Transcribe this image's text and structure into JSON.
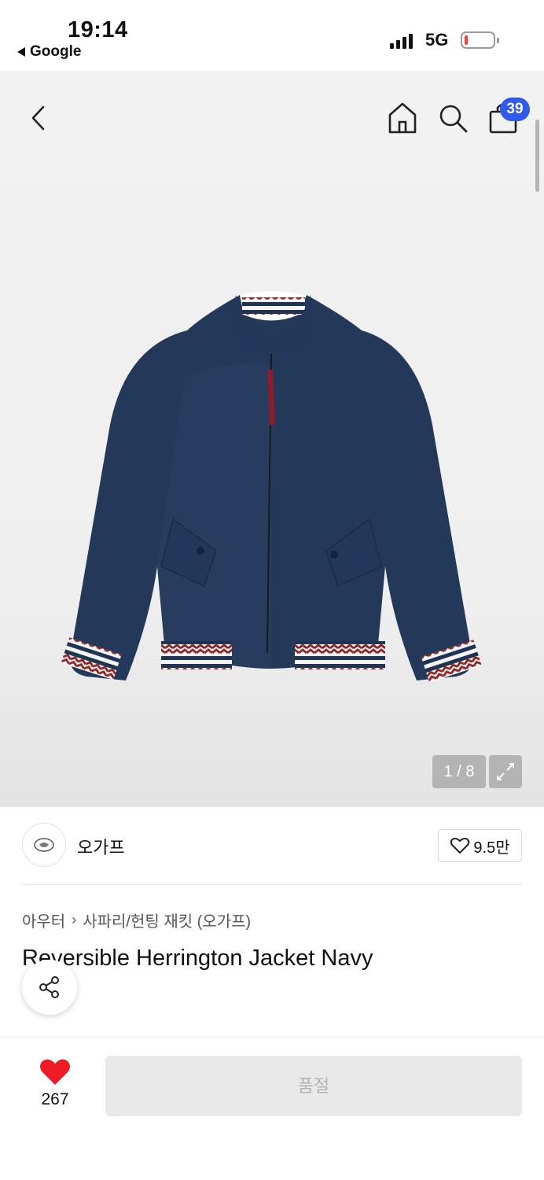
{
  "status_bar": {
    "time": "19:14",
    "back_app": "Google",
    "network": "5G",
    "battery_level": 0.12
  },
  "header": {
    "back_icon": "chevron-left-icon",
    "home_icon": "home-icon",
    "search_icon": "search-icon",
    "bag_icon": "shopping-bag-icon",
    "bag_badge": "39",
    "badge_color": "#2f5bea"
  },
  "gallery": {
    "counter": "1 / 8",
    "expand_icon": "expand-icon"
  },
  "brand": {
    "name": "오가프",
    "likes": "9.5만",
    "heart_icon": "heart-outline-icon"
  },
  "breadcrumb": {
    "category": "아우터",
    "subcategory": "사파리/헌팅 재킷 (오가프)"
  },
  "product": {
    "title": "Reversible Herrington Jacket Navy"
  },
  "bottom_bar": {
    "wish_count": "267",
    "wish_color": "#ee1c25",
    "cta_label": "품절"
  }
}
